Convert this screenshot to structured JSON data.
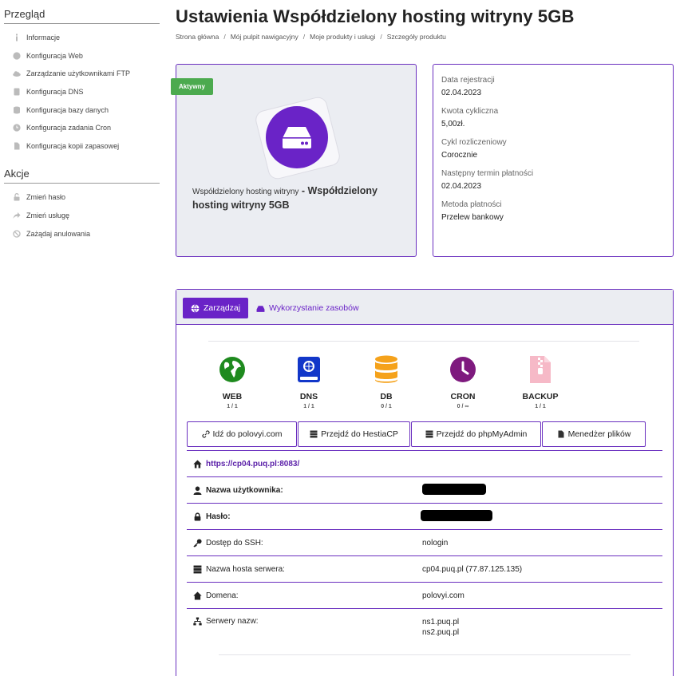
{
  "sidebar": {
    "overview_heading": "Przegląd",
    "overview_items": [
      {
        "label": "Informacje",
        "icon": "info-icon"
      },
      {
        "label": "Konfiguracja Web",
        "icon": "globe-icon"
      },
      {
        "label": "Zarządzanie użytkownikami FTP",
        "icon": "cloud-icon"
      },
      {
        "label": "Konfiguracja DNS",
        "icon": "book-icon"
      },
      {
        "label": "Konfiguracja bazy danych",
        "icon": "database-icon"
      },
      {
        "label": "Konfiguracja zadania Cron",
        "icon": "clock-icon"
      },
      {
        "label": "Konfiguracja kopii zapasowej",
        "icon": "file-icon"
      }
    ],
    "actions_heading": "Akcje",
    "action_items": [
      {
        "label": "Zmień hasło",
        "icon": "unlock-icon"
      },
      {
        "label": "Zmień usługę",
        "icon": "share-icon"
      },
      {
        "label": "Zażądaj anulowania",
        "icon": "ban-icon"
      }
    ]
  },
  "header": {
    "title": "Ustawienia Współdzielony hosting witryny 5GB",
    "breadcrumb": [
      "Strona główna",
      "Mój pulpit nawigacyjny",
      "Moje produkty i usługi",
      "Szczegóły produktu"
    ]
  },
  "product": {
    "status": "Aktywny",
    "group": "Współdzielony hosting witryny",
    "dash": " - ",
    "name": "Współdzielony hosting witryny 5GB"
  },
  "details": [
    {
      "label": "Data rejestracji",
      "value": "02.04.2023"
    },
    {
      "label": "Kwota cykliczna",
      "value": "5,00zł."
    },
    {
      "label": "Cykl rozliczeniowy",
      "value": "Corocznie"
    },
    {
      "label": "Następny termin płatności",
      "value": "02.04.2023"
    },
    {
      "label": "Metoda płatności",
      "value": "Przelew bankowy"
    }
  ],
  "tabs": {
    "manage": "Zarządzaj",
    "usage": "Wykorzystanie zasobów"
  },
  "services": [
    {
      "name": "WEB",
      "count": "1 / 1",
      "icon": "globe-icon",
      "color": "#1e8a1e"
    },
    {
      "name": "DNS",
      "count": "1 / 1",
      "icon": "book-icon",
      "color": "#1237c9"
    },
    {
      "name": "DB",
      "count": "0 / 1",
      "icon": "database-icon",
      "color": "#f5a21b"
    },
    {
      "name": "CRON",
      "count": "0 / ∞",
      "icon": "clock-icon",
      "color": "#7e1a7e"
    },
    {
      "name": "BACKUP",
      "count": "1 / 1",
      "icon": "file-zip-icon",
      "color": "#f6b9c7"
    }
  ],
  "buttons": [
    {
      "label": "Idź do polovyi.com",
      "icon": "link-icon"
    },
    {
      "label": "Przejdź do HestiaCP",
      "icon": "server-icon"
    },
    {
      "label": "Przejdź do phpMyAdmin",
      "icon": "server-icon"
    },
    {
      "label": "Menedżer plików",
      "icon": "file-icon"
    }
  ],
  "info": {
    "url": "https://cp04.puq.pl:8083/",
    "username_label": "Nazwa użytkownika:",
    "password_label": "Hasło:",
    "ssh_label": "Dostęp do SSH:",
    "ssh_value": "nologin",
    "hostname_label": "Nazwa hosta serwera:",
    "hostname_value": "cp04.puq.pl (77.87.125.135)",
    "domain_label": "Domena:",
    "domain_value": "polovyi.com",
    "ns_label": "Serwery nazw:",
    "ns_values": [
      "ns1.puq.pl",
      "ns2.puq.pl"
    ]
  },
  "colors": {
    "accent": "#6a23c7",
    "active_badge": "#4caa4f"
  }
}
